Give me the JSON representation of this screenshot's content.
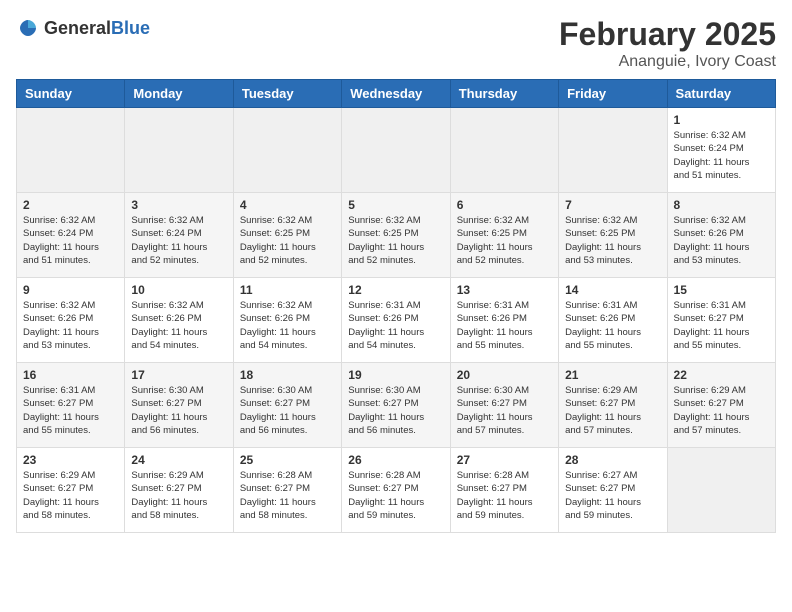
{
  "logo": {
    "general": "General",
    "blue": "Blue"
  },
  "header": {
    "month": "February 2025",
    "location": "Ananguie, Ivory Coast"
  },
  "days_of_week": [
    "Sunday",
    "Monday",
    "Tuesday",
    "Wednesday",
    "Thursday",
    "Friday",
    "Saturday"
  ],
  "weeks": [
    [
      {
        "day": "",
        "info": ""
      },
      {
        "day": "",
        "info": ""
      },
      {
        "day": "",
        "info": ""
      },
      {
        "day": "",
        "info": ""
      },
      {
        "day": "",
        "info": ""
      },
      {
        "day": "",
        "info": ""
      },
      {
        "day": "1",
        "info": "Sunrise: 6:32 AM\nSunset: 6:24 PM\nDaylight: 11 hours\nand 51 minutes."
      }
    ],
    [
      {
        "day": "2",
        "info": "Sunrise: 6:32 AM\nSunset: 6:24 PM\nDaylight: 11 hours\nand 51 minutes."
      },
      {
        "day": "3",
        "info": "Sunrise: 6:32 AM\nSunset: 6:24 PM\nDaylight: 11 hours\nand 52 minutes."
      },
      {
        "day": "4",
        "info": "Sunrise: 6:32 AM\nSunset: 6:25 PM\nDaylight: 11 hours\nand 52 minutes."
      },
      {
        "day": "5",
        "info": "Sunrise: 6:32 AM\nSunset: 6:25 PM\nDaylight: 11 hours\nand 52 minutes."
      },
      {
        "day": "6",
        "info": "Sunrise: 6:32 AM\nSunset: 6:25 PM\nDaylight: 11 hours\nand 52 minutes."
      },
      {
        "day": "7",
        "info": "Sunrise: 6:32 AM\nSunset: 6:25 PM\nDaylight: 11 hours\nand 53 minutes."
      },
      {
        "day": "8",
        "info": "Sunrise: 6:32 AM\nSunset: 6:26 PM\nDaylight: 11 hours\nand 53 minutes."
      }
    ],
    [
      {
        "day": "9",
        "info": "Sunrise: 6:32 AM\nSunset: 6:26 PM\nDaylight: 11 hours\nand 53 minutes."
      },
      {
        "day": "10",
        "info": "Sunrise: 6:32 AM\nSunset: 6:26 PM\nDaylight: 11 hours\nand 54 minutes."
      },
      {
        "day": "11",
        "info": "Sunrise: 6:32 AM\nSunset: 6:26 PM\nDaylight: 11 hours\nand 54 minutes."
      },
      {
        "day": "12",
        "info": "Sunrise: 6:31 AM\nSunset: 6:26 PM\nDaylight: 11 hours\nand 54 minutes."
      },
      {
        "day": "13",
        "info": "Sunrise: 6:31 AM\nSunset: 6:26 PM\nDaylight: 11 hours\nand 55 minutes."
      },
      {
        "day": "14",
        "info": "Sunrise: 6:31 AM\nSunset: 6:26 PM\nDaylight: 11 hours\nand 55 minutes."
      },
      {
        "day": "15",
        "info": "Sunrise: 6:31 AM\nSunset: 6:27 PM\nDaylight: 11 hours\nand 55 minutes."
      }
    ],
    [
      {
        "day": "16",
        "info": "Sunrise: 6:31 AM\nSunset: 6:27 PM\nDaylight: 11 hours\nand 55 minutes."
      },
      {
        "day": "17",
        "info": "Sunrise: 6:30 AM\nSunset: 6:27 PM\nDaylight: 11 hours\nand 56 minutes."
      },
      {
        "day": "18",
        "info": "Sunrise: 6:30 AM\nSunset: 6:27 PM\nDaylight: 11 hours\nand 56 minutes."
      },
      {
        "day": "19",
        "info": "Sunrise: 6:30 AM\nSunset: 6:27 PM\nDaylight: 11 hours\nand 56 minutes."
      },
      {
        "day": "20",
        "info": "Sunrise: 6:30 AM\nSunset: 6:27 PM\nDaylight: 11 hours\nand 57 minutes."
      },
      {
        "day": "21",
        "info": "Sunrise: 6:29 AM\nSunset: 6:27 PM\nDaylight: 11 hours\nand 57 minutes."
      },
      {
        "day": "22",
        "info": "Sunrise: 6:29 AM\nSunset: 6:27 PM\nDaylight: 11 hours\nand 57 minutes."
      }
    ],
    [
      {
        "day": "23",
        "info": "Sunrise: 6:29 AM\nSunset: 6:27 PM\nDaylight: 11 hours\nand 58 minutes."
      },
      {
        "day": "24",
        "info": "Sunrise: 6:29 AM\nSunset: 6:27 PM\nDaylight: 11 hours\nand 58 minutes."
      },
      {
        "day": "25",
        "info": "Sunrise: 6:28 AM\nSunset: 6:27 PM\nDaylight: 11 hours\nand 58 minutes."
      },
      {
        "day": "26",
        "info": "Sunrise: 6:28 AM\nSunset: 6:27 PM\nDaylight: 11 hours\nand 59 minutes."
      },
      {
        "day": "27",
        "info": "Sunrise: 6:28 AM\nSunset: 6:27 PM\nDaylight: 11 hours\nand 59 minutes."
      },
      {
        "day": "28",
        "info": "Sunrise: 6:27 AM\nSunset: 6:27 PM\nDaylight: 11 hours\nand 59 minutes."
      },
      {
        "day": "",
        "info": ""
      }
    ]
  ]
}
